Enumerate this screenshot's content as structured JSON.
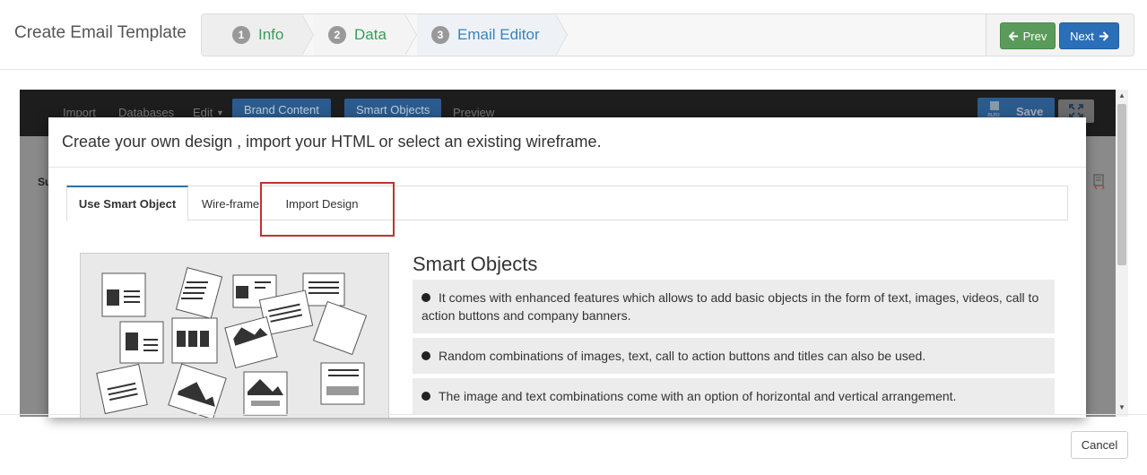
{
  "page": {
    "title": "Create Email Template"
  },
  "wizard": {
    "steps": [
      {
        "num": "1",
        "label": "Info"
      },
      {
        "num": "2",
        "label": "Data"
      },
      {
        "num": "3",
        "label": "Email Editor"
      }
    ],
    "prev_label": "Prev",
    "next_label": "Next"
  },
  "editor_toolbar": {
    "items": [
      "Import",
      "Databases",
      "Edit",
      "Brand Content",
      "Smart Objects",
      "Preview"
    ],
    "save_label": "Save",
    "auto_label": "auto"
  },
  "modal": {
    "title": "Create your own design , import your HTML or select an existing wireframe.",
    "tabs": [
      "Use Smart Object",
      "Wire-frame",
      "Import Design"
    ],
    "section_title": "Smart Objects",
    "features": [
      "It comes with enhanced features which allows to add basic objects in the form of text, images, videos, call to action buttons and company banners.",
      "Random combinations of images, text, call to action buttons and titles can also be used.",
      "The image and text combinations come with an option of horizontal and vertical arrangement."
    ]
  },
  "footer": {
    "cancel_label": "Cancel"
  }
}
